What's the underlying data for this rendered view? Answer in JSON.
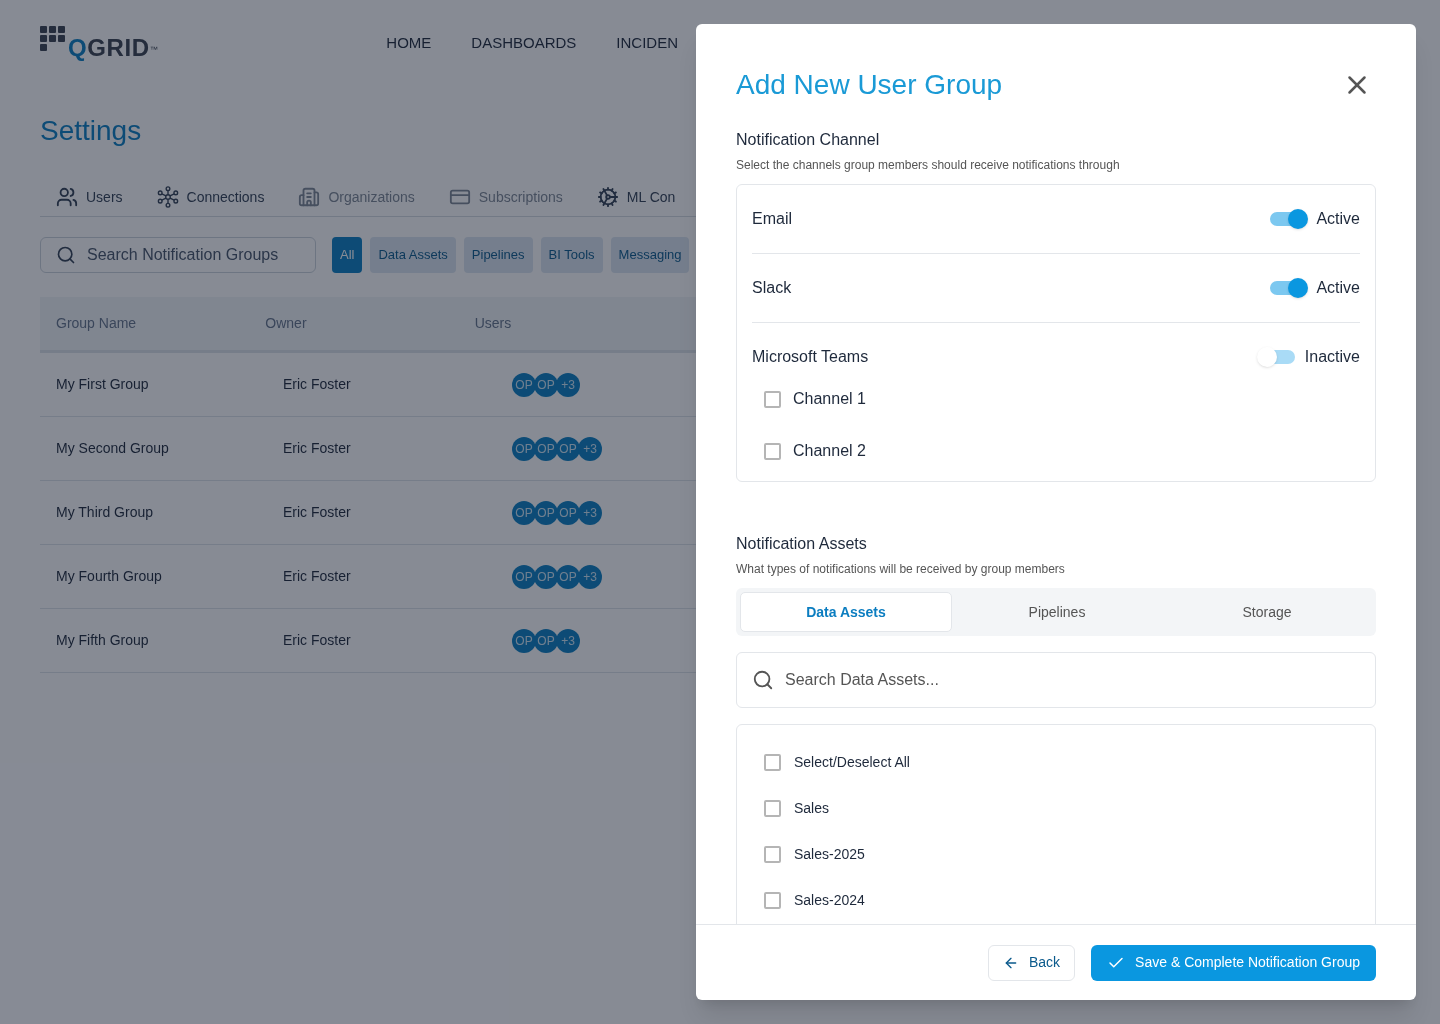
{
  "logo": {
    "text": "QGRID",
    "mark": "™"
  },
  "nav": [
    "HOME",
    "DASHBOARDS",
    "INCIDEN"
  ],
  "page_title": "Settings",
  "settings_tabs": [
    {
      "label": "Users",
      "disabled": false
    },
    {
      "label": "Connections",
      "disabled": false
    },
    {
      "label": "Organizations",
      "disabled": true
    },
    {
      "label": "Subscriptions",
      "disabled": true
    },
    {
      "label": "ML Con",
      "disabled": false
    }
  ],
  "search": {
    "placeholder": "Search Notification Groups"
  },
  "filters": [
    {
      "label": "All",
      "selected": true
    },
    {
      "label": "Data Assets",
      "selected": false
    },
    {
      "label": "Pipelines",
      "selected": false
    },
    {
      "label": "BI Tools",
      "selected": false
    },
    {
      "label": "Messaging",
      "selected": false
    }
  ],
  "table": {
    "columns": [
      "Group Name",
      "Owner",
      "Users"
    ],
    "rows": [
      {
        "group_name": "My First Group",
        "owner": "Eric Foster",
        "users": [
          "OP",
          "OP",
          "+3"
        ]
      },
      {
        "group_name": "My Second Group",
        "owner": "Eric Foster",
        "users": [
          "OP",
          "OP",
          "OP",
          "+3"
        ]
      },
      {
        "group_name": "My Third Group",
        "owner": "Eric Foster",
        "users": [
          "OP",
          "OP",
          "OP",
          "+3"
        ]
      },
      {
        "group_name": "My Fourth Group",
        "owner": "Eric Foster",
        "users": [
          "OP",
          "OP",
          "OP",
          "+3"
        ]
      },
      {
        "group_name": "My Fifth Group",
        "owner": "Eric Foster",
        "users": [
          "OP",
          "OP",
          "+3"
        ]
      }
    ]
  },
  "modal": {
    "title": "Add New User Group",
    "channel_section": {
      "title": "Notification Channel",
      "subtitle": "Select the channels group members should receive notifications through",
      "channels": [
        {
          "name": "Email",
          "on": true,
          "status": "Active"
        },
        {
          "name": "Slack",
          "on": true,
          "status": "Active"
        },
        {
          "name": "Microsoft Teams",
          "on": false,
          "status": "Inactive",
          "sub_channels": [
            {
              "label": "Channel 1",
              "checked": false
            },
            {
              "label": "Channel 2",
              "checked": false
            }
          ]
        }
      ]
    },
    "assets_section": {
      "title": "Notification Assets",
      "subtitle": "What types of notifications will be received by group members",
      "tabs": [
        {
          "label": "Data Assets",
          "selected": true
        },
        {
          "label": "Pipelines",
          "selected": false
        },
        {
          "label": "Storage",
          "selected": false
        }
      ],
      "search_placeholder": "Search Data Assets...",
      "items": [
        {
          "label": "Select/Deselect All",
          "checked": false
        },
        {
          "label": "Sales",
          "checked": false
        },
        {
          "label": "Sales-2025",
          "checked": false
        },
        {
          "label": "Sales-2024",
          "checked": false
        }
      ]
    },
    "buttons": {
      "back": "Back",
      "save": "Save & Complete Notification Group"
    }
  }
}
